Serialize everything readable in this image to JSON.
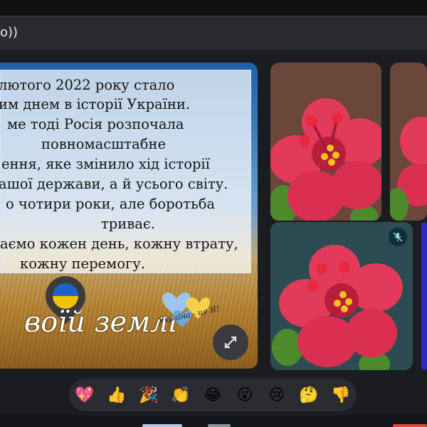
{
  "window": {
    "title": "o))"
  },
  "shared_slide": {
    "lines": [
      "лютого 2022 року стало",
      "им днем в історії України.",
      "ме тоді Росія розпочала",
      "повномасштабне",
      "ення, яке змінило хід історії",
      "ашої держави, а й усього світу.",
      "о чотири роки, але боротьба",
      "триває.",
      "аємо кожен день, кожну втрату,",
      "кожну перемогу."
    ],
    "script_text": "воїй землі",
    "sticker_text": "Україна - це Я!"
  },
  "reactions": [
    {
      "name": "sparkling-heart",
      "glyph": "💖"
    },
    {
      "name": "thumbs-up",
      "glyph": "👍"
    },
    {
      "name": "party-popper",
      "glyph": "🎉"
    },
    {
      "name": "clapping-hands",
      "glyph": "👏"
    },
    {
      "name": "tears-of-joy",
      "glyph": "😂"
    },
    {
      "name": "surprised",
      "glyph": "😮"
    },
    {
      "name": "crying",
      "glyph": "😢"
    },
    {
      "name": "thinking",
      "glyph": "🤔"
    },
    {
      "name": "thumbs-down",
      "glyph": "👎"
    }
  ],
  "icons": {
    "expand": "expand-icon",
    "mic_off": "mic-off-icon",
    "participant_avatar": "hibiscus-icon"
  },
  "colors": {
    "flag_blue": "#1d63c9",
    "flag_yellow": "#f2c200",
    "hibiscus": "#e23b5a"
  }
}
